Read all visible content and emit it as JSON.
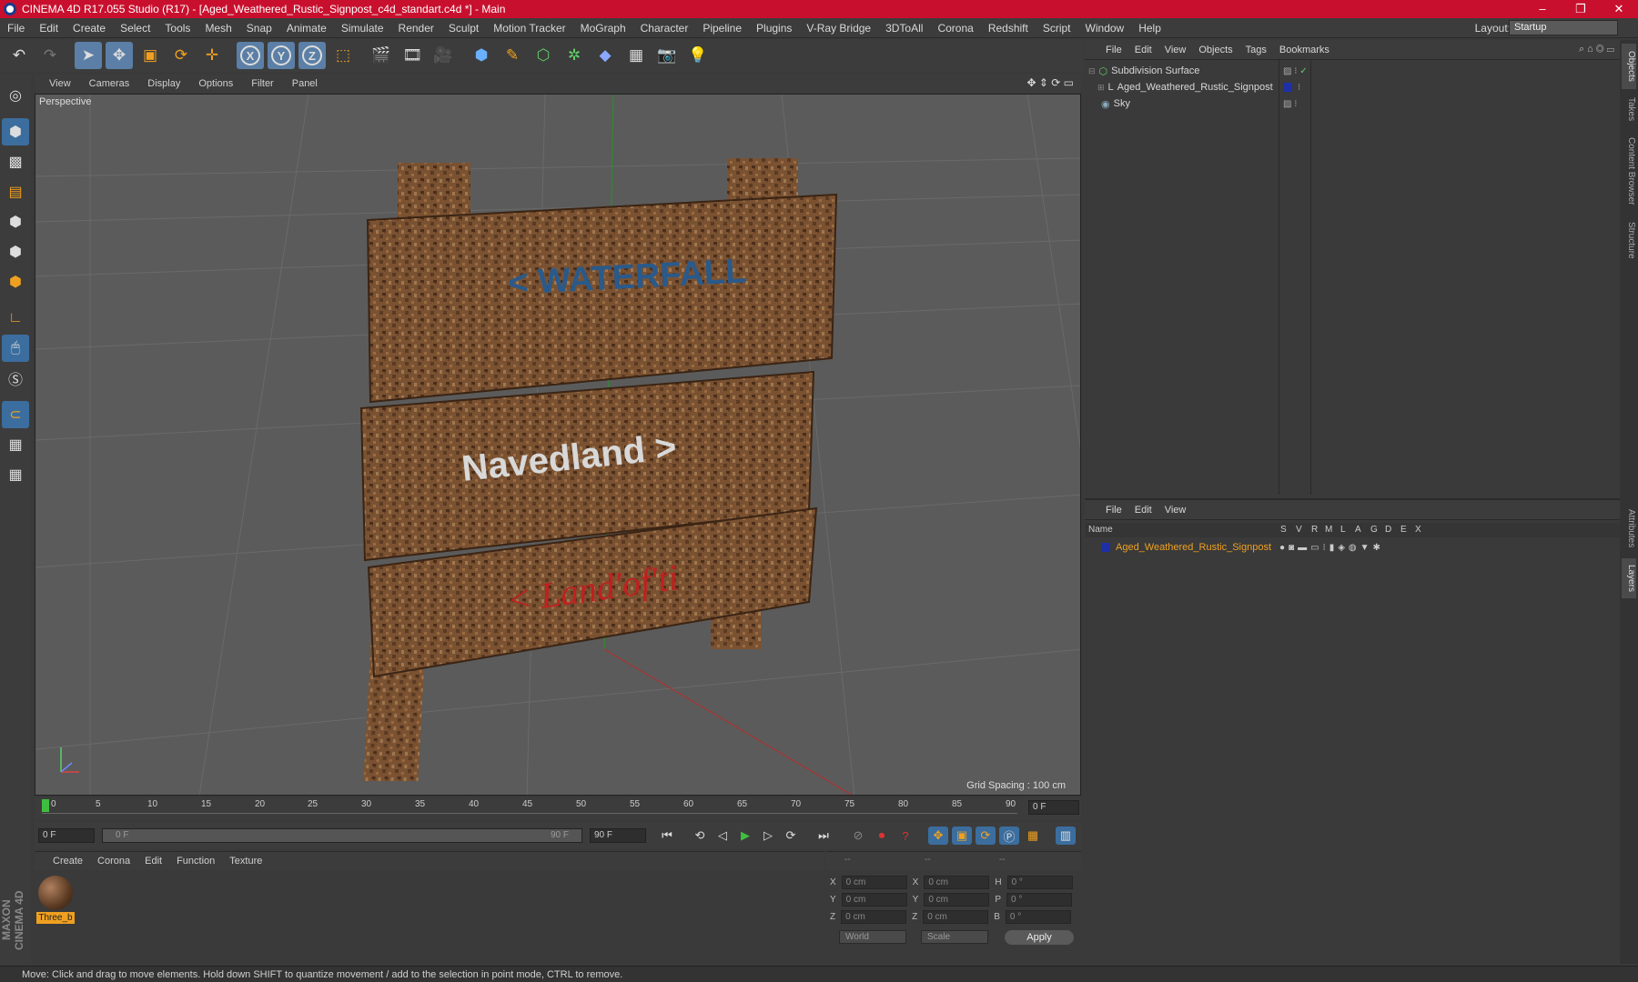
{
  "window": {
    "title": "CINEMA 4D R17.055 Studio (R17) - [Aged_Weathered_Rustic_Signpost_c4d_standart.c4d *] - Main",
    "controls": [
      "–",
      "❐",
      "✕"
    ]
  },
  "menu": [
    "File",
    "Edit",
    "Create",
    "Select",
    "Tools",
    "Mesh",
    "Snap",
    "Animate",
    "Simulate",
    "Render",
    "Sculpt",
    "Motion Tracker",
    "MoGraph",
    "Character",
    "Pipeline",
    "Plugins",
    "V-Ray Bridge",
    "3DToAll",
    "Corona",
    "Redshift",
    "Script",
    "Window",
    "Help"
  ],
  "layout": {
    "label": "Layout:",
    "value": "Startup"
  },
  "toolbar_axes": [
    "X",
    "Y",
    "Z"
  ],
  "viewport": {
    "menu": [
      "View",
      "Cameras",
      "Display",
      "Options",
      "Filter",
      "Panel"
    ],
    "label": "Perspective",
    "grid_spacing": "Grid Spacing : 100 cm"
  },
  "timeline": {
    "ticks": [
      "0",
      "5",
      "10",
      "15",
      "20",
      "25",
      "30",
      "35",
      "40",
      "45",
      "50",
      "55",
      "60",
      "65",
      "70",
      "75",
      "80",
      "85",
      "90"
    ],
    "current_frame": "0 F",
    "start": "0 F",
    "range_start": "0 F",
    "range_end": "90 F",
    "end": "90 F"
  },
  "materials": {
    "menu": [
      "Create",
      "Corona",
      "Edit",
      "Function",
      "Texture"
    ],
    "items": [
      {
        "name": "Three_b"
      }
    ]
  },
  "coordinates": {
    "headers": [
      "--",
      "--",
      "--"
    ],
    "rows": [
      {
        "a": "X",
        "pos": "0 cm",
        "b": "X",
        "size": "0 cm",
        "c": "H",
        "rot": "0 °"
      },
      {
        "a": "Y",
        "pos": "0 cm",
        "b": "Y",
        "size": "0 cm",
        "c": "P",
        "rot": "0 °"
      },
      {
        "a": "Z",
        "pos": "0 cm",
        "b": "Z",
        "size": "0 cm",
        "c": "B",
        "rot": "0 °"
      }
    ],
    "mode": "World",
    "scale": "Scale",
    "apply": "Apply"
  },
  "object_manager": {
    "menu": [
      "File",
      "Edit",
      "View",
      "Objects",
      "Tags",
      "Bookmarks"
    ],
    "objects": [
      {
        "name": "Subdivision Surface",
        "indent": 0
      },
      {
        "name": "Aged_Weathered_Rustic_Signpost",
        "indent": 1
      },
      {
        "name": "Sky",
        "indent": 0
      }
    ]
  },
  "layer_manager": {
    "menu": [
      "File",
      "Edit",
      "View"
    ],
    "columns": [
      "Name",
      "S",
      "V",
      "R",
      "M",
      "L",
      "A",
      "G",
      "D",
      "E",
      "X"
    ],
    "layers": [
      {
        "name": "Aged_Weathered_Rustic_Signpost"
      }
    ]
  },
  "right_tabs": [
    "Objects",
    "Takes",
    "Content Browser",
    "Structure",
    "Attributes",
    "Layers"
  ],
  "brand": "MAXON CINEMA 4D",
  "status": "Move: Click and drag to move elements. Hold down SHIFT to quantize movement / add to the selection in point mode, CTRL to remove.",
  "sign_texts": [
    "< WATERFALL",
    "Navedland >",
    "< Land'of'ti"
  ],
  "colors": {
    "accent": "#c8102e",
    "selection": "#f0a020",
    "layer": "#1e2fa8"
  }
}
